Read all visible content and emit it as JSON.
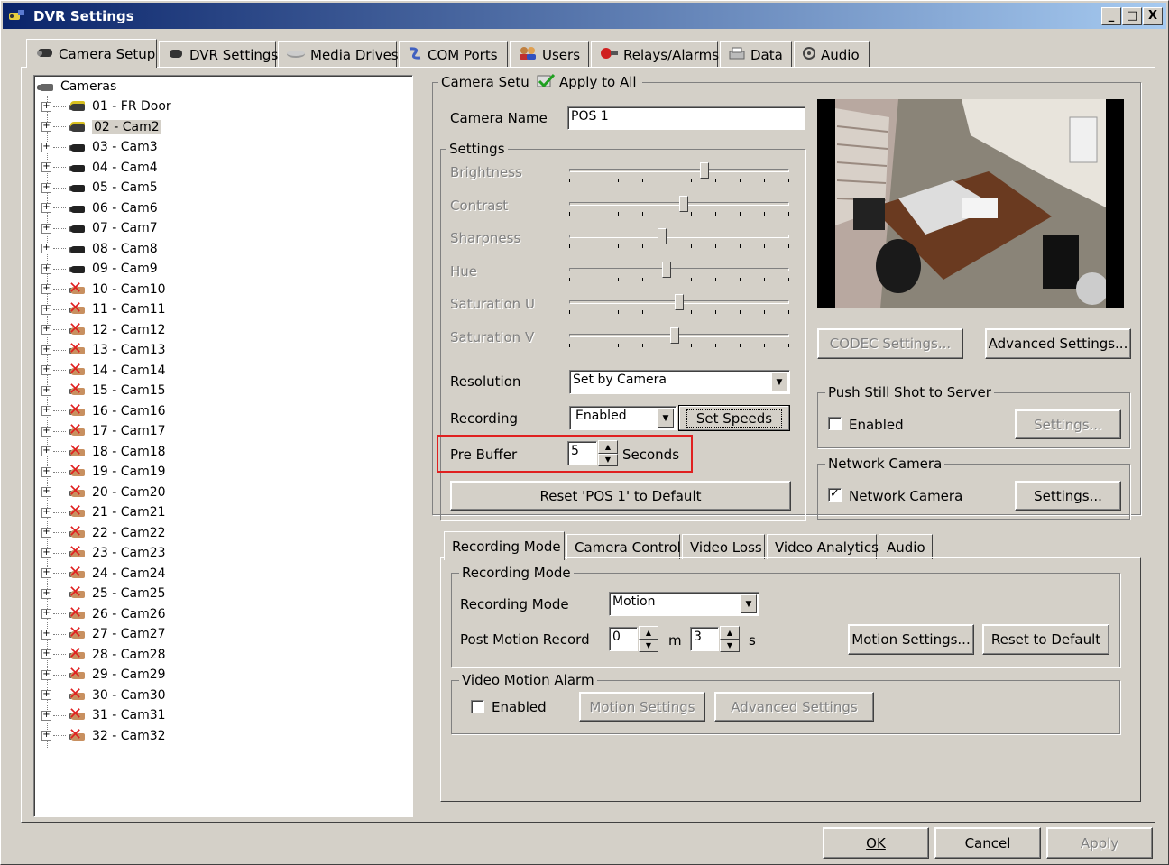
{
  "window": {
    "title": "DVR Settings",
    "controls": [
      "_",
      "□",
      "X"
    ]
  },
  "main_tabs": [
    {
      "label": "Camera Setup",
      "icon": "camera-icon"
    },
    {
      "label": "DVR Settings",
      "icon": "dvr-icon"
    },
    {
      "label": "Media Drives",
      "icon": "drive-icon"
    },
    {
      "label": "COM Ports",
      "icon": "com-port-icon"
    },
    {
      "label": "Users",
      "icon": "users-icon"
    },
    {
      "label": "Relays/Alarms",
      "icon": "alarm-icon"
    },
    {
      "label": "Data",
      "icon": "data-icon"
    },
    {
      "label": "Audio",
      "icon": "audio-icon"
    }
  ],
  "tree": {
    "root": "Cameras",
    "items": [
      {
        "label": "01 - FR Door",
        "state": "yellow"
      },
      {
        "label": "02 - Cam2",
        "state": "yellow"
      },
      {
        "label": "03 - Cam3",
        "state": "black"
      },
      {
        "label": "04 - Cam4",
        "state": "black"
      },
      {
        "label": "05 - Cam5",
        "state": "black"
      },
      {
        "label": "06 - Cam6",
        "state": "black"
      },
      {
        "label": "07 - Cam7",
        "state": "black"
      },
      {
        "label": "08 - Cam8",
        "state": "black"
      },
      {
        "label": "09 - Cam9",
        "state": "black"
      },
      {
        "label": "10 - Cam10",
        "state": "disabled"
      },
      {
        "label": "11 - Cam11",
        "state": "disabled"
      },
      {
        "label": "12 - Cam12",
        "state": "disabled"
      },
      {
        "label": "13 - Cam13",
        "state": "disabled"
      },
      {
        "label": "14 - Cam14",
        "state": "disabled"
      },
      {
        "label": "15 - Cam15",
        "state": "disabled"
      },
      {
        "label": "16 - Cam16",
        "state": "disabled"
      },
      {
        "label": "17 - Cam17",
        "state": "disabled"
      },
      {
        "label": "18 - Cam18",
        "state": "disabled"
      },
      {
        "label": "19 - Cam19",
        "state": "disabled"
      },
      {
        "label": "20 - Cam20",
        "state": "disabled"
      },
      {
        "label": "21 - Cam21",
        "state": "disabled"
      },
      {
        "label": "22 - Cam22",
        "state": "disabled"
      },
      {
        "label": "23 - Cam23",
        "state": "disabled"
      },
      {
        "label": "24 - Cam24",
        "state": "disabled"
      },
      {
        "label": "25 - Cam25",
        "state": "disabled"
      },
      {
        "label": "26 - Cam26",
        "state": "disabled"
      },
      {
        "label": "27 - Cam27",
        "state": "disabled"
      },
      {
        "label": "28 - Cam28",
        "state": "disabled"
      },
      {
        "label": "29 - Cam29",
        "state": "disabled"
      },
      {
        "label": "30 - Cam30",
        "state": "disabled"
      },
      {
        "label": "31 - Cam31",
        "state": "disabled"
      },
      {
        "label": "32 - Cam32",
        "state": "disabled"
      }
    ],
    "selected_index": 1
  },
  "camera_setup": {
    "group_label": "Camera Setup",
    "apply_all": "Apply to All",
    "camera_name_label": "Camera Name",
    "camera_name_value": "POS 1",
    "settings_label": "Settings",
    "sliders": [
      {
        "label": "Brightness",
        "value": 0.62
      },
      {
        "label": "Contrast",
        "value": 0.52
      },
      {
        "label": "Sharpness",
        "value": 0.42
      },
      {
        "label": "Hue",
        "value": 0.44
      },
      {
        "label": "Saturation U",
        "value": 0.5
      },
      {
        "label": "Saturation V",
        "value": 0.48
      }
    ],
    "resolution_label": "Resolution",
    "resolution_value": "Set by Camera",
    "recording_label": "Recording",
    "recording_value": "Enabled",
    "set_speeds": "Set Speeds",
    "prebuffer_label": "Pre Buffer",
    "prebuffer_value": "5",
    "prebuffer_unit": "Seconds",
    "reset_button": "Reset 'POS 1' to Default",
    "codec_button": "CODEC Settings...",
    "advanced_button": "Advanced Settings...",
    "push_group": "Push Still Shot to Server",
    "push_enabled": "Enabled",
    "push_settings": "Settings...",
    "network_group": "Network Camera",
    "network_check": "Network Camera",
    "network_settings": "Settings...",
    "highlight_color": "#e02020"
  },
  "sub_tabs": [
    "Recording Mode",
    "Camera Control",
    "Video Loss",
    "Video Analytics",
    "Audio"
  ],
  "recording_mode": {
    "group_label": "Recording Mode",
    "mode_label": "Recording Mode",
    "mode_value": "Motion",
    "post_label": "Post Motion Record",
    "minutes_value": "0",
    "minutes_unit": "m",
    "seconds_value": "3",
    "seconds_unit": "s",
    "motion_settings_button": "Motion Settings...",
    "reset_default_button": "Reset to Default",
    "alarm_group": "Video Motion Alarm",
    "alarm_enabled": "Enabled",
    "alarm_motion_settings": "Motion Settings",
    "alarm_advanced_settings": "Advanced Settings"
  },
  "footer": {
    "ok": "OK",
    "cancel": "Cancel",
    "apply": "Apply"
  }
}
